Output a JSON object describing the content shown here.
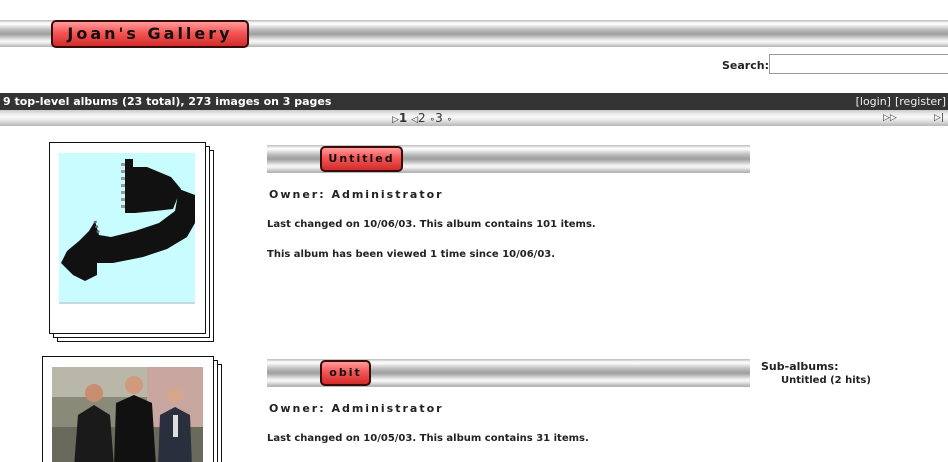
{
  "gallery": {
    "title": "Joan's Gallery"
  },
  "search": {
    "label": "Search:",
    "value": "",
    "placeholder": ""
  },
  "status": {
    "text": "9 top-level albums (23 total), 273 images on 3 pages",
    "login": "[login]",
    "register": "[register]"
  },
  "pager": {
    "current": "1",
    "page2": "2",
    "page3": "3"
  },
  "albums": [
    {
      "title": "Untitled",
      "owner": "Owner: Administrator",
      "changed": "Last changed on 10/06/03.  This album contains 101 items.",
      "views": "This album has been viewed 1 time since 10/06/03."
    },
    {
      "title": "obit",
      "owner": "Owner: Administrator",
      "changed": "Last changed on 10/05/03.  This album contains 31 items.",
      "subalbums_label": "Sub-albums:",
      "subalbums": [
        "Untitled (2 hits)"
      ]
    }
  ],
  "colors": {
    "pill": "#f55555",
    "statusbar": "#333333",
    "thumb_bg": "#c8fcff"
  },
  "icons": {
    "next": "triangle-right-icon",
    "prev": "triangle-left-icon",
    "sep": "dot-icon"
  }
}
